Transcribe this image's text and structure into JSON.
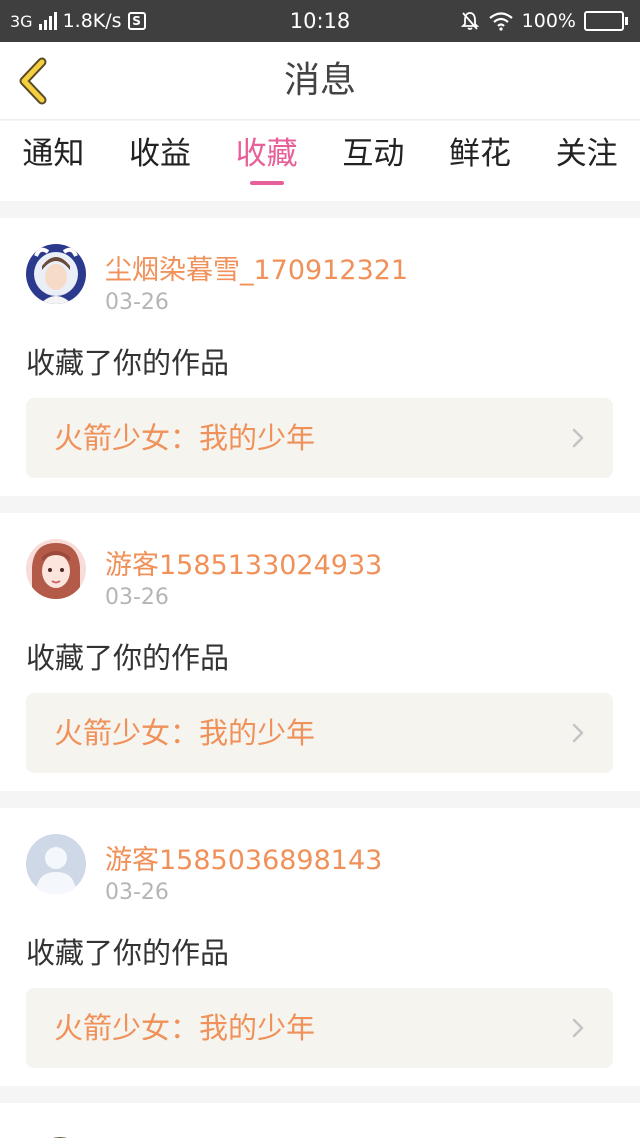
{
  "status_bar": {
    "network": "3G",
    "speed": "1.8K/s",
    "s_badge": "S",
    "time": "10:18",
    "battery": "100%"
  },
  "header": {
    "title": "消息"
  },
  "tabs": [
    {
      "label": "通知",
      "active": false
    },
    {
      "label": "收益",
      "active": false
    },
    {
      "label": "收藏",
      "active": true
    },
    {
      "label": "互动",
      "active": false
    },
    {
      "label": "鲜花",
      "active": false
    },
    {
      "label": "关注",
      "active": false
    }
  ],
  "messages": [
    {
      "username": "尘烟染暮雪_170912321",
      "date": "03-26",
      "action": "收藏了你的作品",
      "work_title": "火箭少女：我的少年",
      "avatar": "avatar-photo-1"
    },
    {
      "username": "游客1585133024933",
      "date": "03-26",
      "action": "收藏了你的作品",
      "work_title": "火箭少女：我的少年",
      "avatar": "avatar-photo-2"
    },
    {
      "username": "游客1585036898143",
      "date": "03-26",
      "action": "收藏了你的作品",
      "work_title": "火箭少女：我的少年",
      "avatar": "default-avatar"
    }
  ],
  "colors": {
    "accent": "#e8609a",
    "username": "#f0915a",
    "status_bar": "#3f3f3f"
  }
}
